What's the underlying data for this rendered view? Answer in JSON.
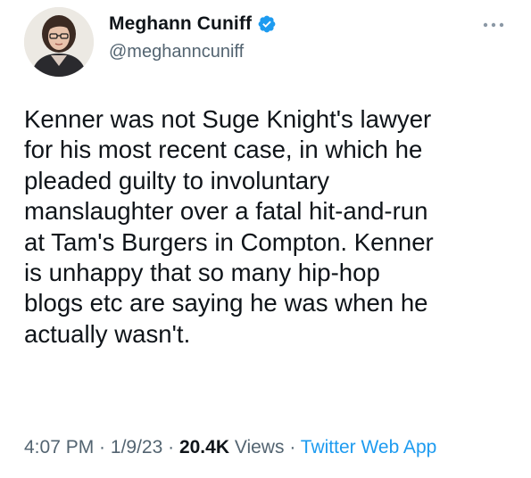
{
  "author": {
    "display_name": "Meghann Cuniff",
    "handle": "@meghanncuniff",
    "verified": true,
    "verified_color": "#1d9bf0"
  },
  "tweet": {
    "text": "Kenner was not Suge Knight's lawyer\nfor his most recent case, in which he\npleaded guilty to involuntary\nmanslaughter over a fatal hit-and-run\nat Tam's Burgers in Compton. Kenner\nis unhappy that so many hip-hop\nblogs etc are saying he was when he\nactually wasn't."
  },
  "meta": {
    "time": "4:07 PM",
    "separator": " · ",
    "date": "1/9/23",
    "views_count": "20.4K",
    "views_label": " Views",
    "source": "Twitter Web App"
  },
  "icons": {
    "more": "more-horizontal-icon",
    "verified": "verified-badge-icon"
  },
  "colors": {
    "text_primary": "#0f1419",
    "text_secondary": "#536471",
    "accent": "#1d9bf0"
  }
}
